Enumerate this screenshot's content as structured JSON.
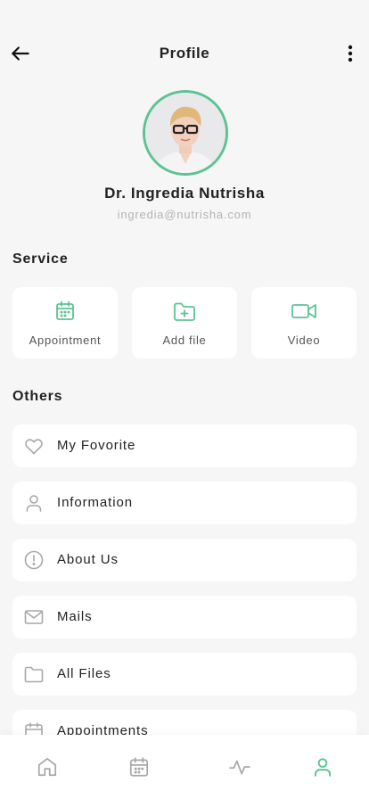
{
  "header": {
    "title": "Profile"
  },
  "profile": {
    "name": "Dr. Ingredia Nutrisha",
    "email": "ingredia@nutrisha.com"
  },
  "service": {
    "title": "Service",
    "items": [
      {
        "label": "Appointment",
        "icon": "calendar-icon"
      },
      {
        "label": "Add file",
        "icon": "folder-plus-icon"
      },
      {
        "label": "Video",
        "icon": "video-camera-icon"
      }
    ]
  },
  "others": {
    "title": "Others",
    "items": [
      {
        "label": "My Fovorite",
        "icon": "heart-icon"
      },
      {
        "label": "Information",
        "icon": "user-icon"
      },
      {
        "label": "About Us",
        "icon": "info-circle-icon"
      },
      {
        "label": "Mails",
        "icon": "mail-icon"
      },
      {
        "label": "All Files",
        "icon": "folder-icon"
      },
      {
        "label": "Appointments",
        "icon": "calendar-icon"
      }
    ]
  },
  "bottom_nav": {
    "items": [
      {
        "icon": "home-icon",
        "active": false
      },
      {
        "icon": "calendar-icon",
        "active": false
      },
      {
        "icon": "activity-icon",
        "active": false
      },
      {
        "icon": "user-icon",
        "active": true
      }
    ]
  },
  "colors": {
    "accent": "#5cc394",
    "background": "#f6f6f6",
    "card": "#ffffff",
    "muted_icon": "#a8a8a8"
  }
}
